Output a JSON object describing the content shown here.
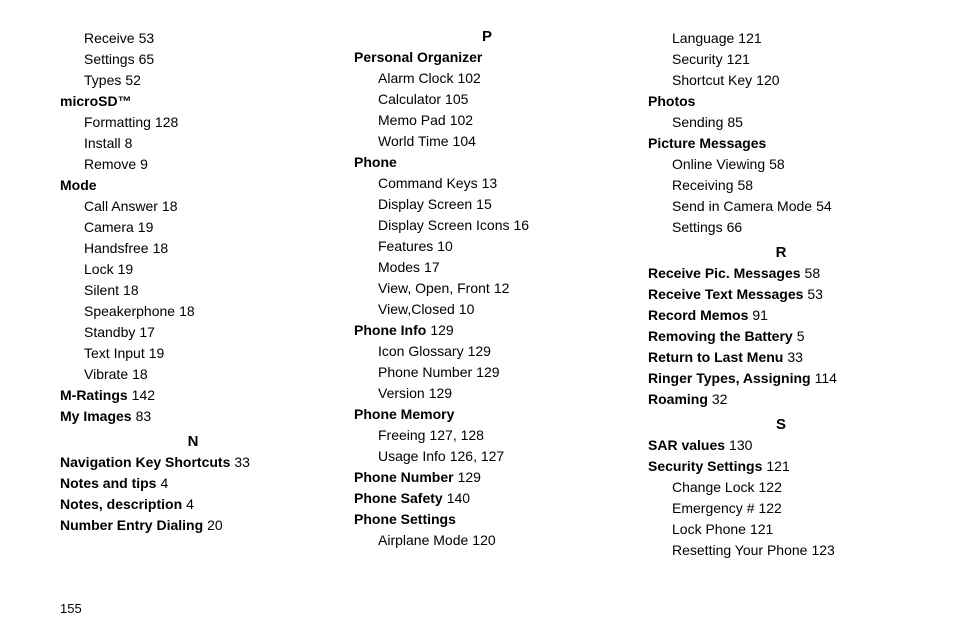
{
  "page_number": "155",
  "col1": {
    "items_top": [
      {
        "label": "Receive",
        "page": "53",
        "sub": true
      },
      {
        "label": "Settings",
        "page": "65",
        "sub": true
      },
      {
        "label": "Types",
        "page": "52",
        "sub": true
      }
    ],
    "microsd": {
      "label": "microSD™",
      "items": [
        {
          "label": "Formatting",
          "page": "128"
        },
        {
          "label": "Install",
          "page": "8"
        },
        {
          "label": "Remove",
          "page": "9"
        }
      ]
    },
    "mode": {
      "label": "Mode",
      "items": [
        {
          "label": "Call Answer",
          "page": "18"
        },
        {
          "label": "Camera",
          "page": "19"
        },
        {
          "label": "Handsfree",
          "page": "18"
        },
        {
          "label": "Lock",
          "page": "19"
        },
        {
          "label": "Silent",
          "page": "18"
        },
        {
          "label": "Speakerphone",
          "page": "18"
        },
        {
          "label": "Standby",
          "page": "17"
        },
        {
          "label": "Text Input",
          "page": "19"
        },
        {
          "label": "Vibrate",
          "page": "18"
        }
      ]
    },
    "mratings": {
      "label": "M-Ratings",
      "page": "142"
    },
    "myimages": {
      "label": "My Images",
      "page": "83"
    },
    "section_n": "N",
    "nav_shortcuts": {
      "label": "Navigation Key Shortcuts",
      "page": "33"
    },
    "notes_tips": {
      "label": "Notes and tips",
      "page": "4"
    },
    "notes_desc": {
      "label": "Notes, description",
      "page": "4"
    },
    "num_entry": {
      "label": "Number Entry Dialing",
      "page": "20"
    }
  },
  "col2": {
    "section_p": "P",
    "personal_org": {
      "label": "Personal Organizer",
      "items": [
        {
          "label": "Alarm Clock",
          "page": "102"
        },
        {
          "label": "Calculator",
          "page": "105"
        },
        {
          "label": "Memo Pad",
          "page": "102"
        },
        {
          "label": "World Time",
          "page": "104"
        }
      ]
    },
    "phone": {
      "label": "Phone",
      "items": [
        {
          "label": "Command Keys",
          "page": "13"
        },
        {
          "label": "Display Screen",
          "page": "15"
        },
        {
          "label": "Display Screen Icons",
          "page": "16"
        },
        {
          "label": "Features",
          "page": "10"
        },
        {
          "label": "Modes",
          "page": "17"
        },
        {
          "label": "View, Open, Front",
          "page": "12"
        },
        {
          "label": "View,Closed",
          "page": "10"
        }
      ]
    },
    "phone_info": {
      "label": "Phone Info",
      "page": "129",
      "items": [
        {
          "label": "Icon Glossary",
          "page": "129"
        },
        {
          "label": "Phone Number",
          "page": "129"
        },
        {
          "label": "Version",
          "page": "129"
        }
      ]
    },
    "phone_memory": {
      "label": "Phone Memory",
      "freeing_label": "Freeing",
      "freeing_p1": "127",
      "freeing_p2": "128",
      "usage_label": "Usage Info",
      "usage_p1": "126",
      "usage_p2": "127"
    },
    "phone_number": {
      "label": "Phone Number",
      "page": "129"
    },
    "phone_safety": {
      "label": "Phone Safety",
      "page": "140"
    },
    "phone_settings": {
      "label": "Phone Settings",
      "airplane": {
        "label": "Airplane Mode",
        "page": "120"
      }
    }
  },
  "col3": {
    "top_items": [
      {
        "label": "Language",
        "page": "121"
      },
      {
        "label": "Security",
        "page": "121"
      },
      {
        "label": "Shortcut Key",
        "page": "120"
      }
    ],
    "photos": {
      "label": "Photos",
      "sending": {
        "label": "Sending",
        "page": "85"
      }
    },
    "picture_msgs": {
      "label": "Picture Messages",
      "items": [
        {
          "label": "Online Viewing",
          "page": "58"
        },
        {
          "label": "Receiving",
          "page": "58"
        },
        {
          "label": "Send in Camera Mode",
          "page": "54"
        },
        {
          "label": "Settings",
          "page": "66"
        }
      ]
    },
    "section_r": "R",
    "r_items": [
      {
        "label": "Receive Pic. Messages",
        "page": "58"
      },
      {
        "label": "Receive Text Messages",
        "page": "53"
      },
      {
        "label": "Record Memos",
        "page": "91"
      },
      {
        "label": "Removing the Battery",
        "page": "5"
      },
      {
        "label": "Return to Last Menu",
        "page": "33"
      },
      {
        "label": "Ringer Types, Assigning",
        "page": "114"
      },
      {
        "label": "Roaming",
        "page": "32"
      }
    ],
    "section_s": "S",
    "sar": {
      "label": "SAR values",
      "page": "130"
    },
    "security": {
      "label": "Security Settings",
      "page": "121",
      "items": [
        {
          "label": "Change Lock",
          "page": "122"
        },
        {
          "label": "Emergency #",
          "page": "122"
        },
        {
          "label": "Lock Phone",
          "page": "121"
        },
        {
          "label": "Resetting Your Phone",
          "page": "123"
        }
      ]
    }
  }
}
